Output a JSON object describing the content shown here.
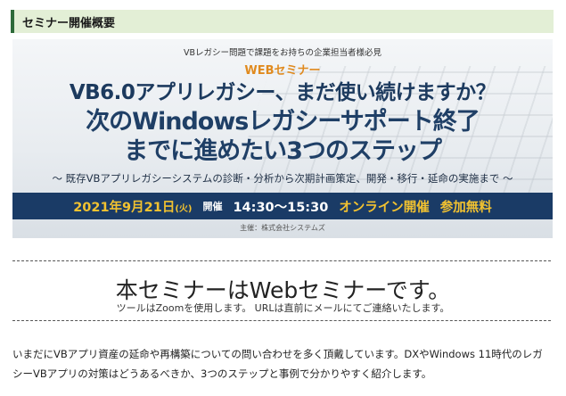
{
  "section": {
    "title": "セミナー開催概要"
  },
  "banner": {
    "top_note": "VBレガシー問題で課題をお持ちの企業担当者様必見",
    "tag": "WEBセミナー",
    "line1": "VB6.0アプリレガシー、まだ使い続けますか？",
    "line2": "次のWindowsレガシーサポート終了",
    "line3": "までに進めたい3つのステップ",
    "description": "〜 既存VBアプリレガシーシステムの診断・分析から次期計画策定、開発・移行・延命の実施まで 〜",
    "date": "2021年9月21日",
    "weekday": "(火)",
    "held": "開催",
    "time": "14:30〜15:30",
    "online": "オンライン開催",
    "free": "参加無料",
    "host": "主催：株式会社システムズ"
  },
  "notice": {
    "headline": "本セミナーはWebセミナーです。",
    "sub": "ツールはZoomを使用します。 URLは直前にメールにてご連絡いたします。"
  },
  "intro": {
    "text": "いまだにVBアプリ資産の延命や再構築についての問い合わせを多く頂戴しています。DXやWindows 11時代のレガシーVBアプリの対策はどうあるべきか、3つのステップと事例で分かりやすく紹介します。"
  }
}
